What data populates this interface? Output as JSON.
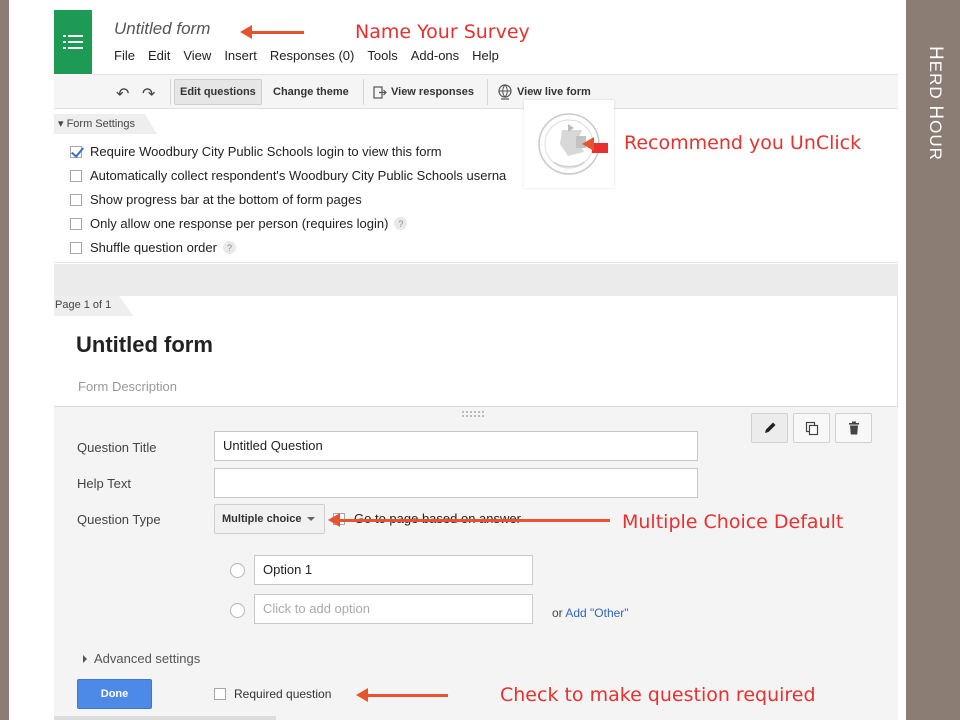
{
  "slide": {
    "side_title_first": "H",
    "side_title_rest1": "ERD ",
    "side_title_second": "H",
    "side_title_rest2": "OUR"
  },
  "app": {
    "form_title": "Untitled form",
    "menu": [
      "File",
      "Edit",
      "View",
      "Insert",
      "Responses (0)",
      "Tools",
      "Add-ons",
      "Help"
    ]
  },
  "toolbar": {
    "edit_questions": "Edit questions",
    "change_theme": "Change theme",
    "view_responses": "View responses",
    "view_live_form": "View live form"
  },
  "settings": {
    "tab_label": "Form Settings",
    "options": [
      {
        "label": "Require Woodbury City Public Schools login to view this form",
        "checked": true
      },
      {
        "label": "Automatically collect respondent's Woodbury City Public Schools userna",
        "checked": false
      },
      {
        "label": "Show progress bar at the bottom of form pages",
        "checked": false
      },
      {
        "label": "Only allow one response per person (requires login)",
        "checked": false
      },
      {
        "label": "Shuffle question order",
        "checked": false
      }
    ]
  },
  "page": {
    "tab_label": "Page 1 of 1",
    "title": "Untitled form",
    "description": "Form Description"
  },
  "question": {
    "title_label": "Question Title",
    "title_value": "Untitled Question",
    "help_label": "Help Text",
    "help_value": "",
    "type_label": "Question Type",
    "type_value": "Multiple choice",
    "goto_label": "Go to page based on answer",
    "option1": "Option 1",
    "add_option_placeholder": "Click to add option",
    "or_text": "or",
    "add_other": "Add \"Other\"",
    "advanced": "Advanced settings",
    "done": "Done",
    "required_label": "Required question"
  },
  "annotations": {
    "name_survey": "Name Your Survey",
    "unclick": "Recommend you UnClick",
    "mc_default": "Multiple Choice Default",
    "required": "Check to make question required"
  },
  "colors": {
    "annotation_red": "#e8312f",
    "arrow_orange": "#e8532f",
    "forms_green": "#1d9a54",
    "done_blue": "#4d8ae8",
    "slide_border": "#8b7d73"
  }
}
